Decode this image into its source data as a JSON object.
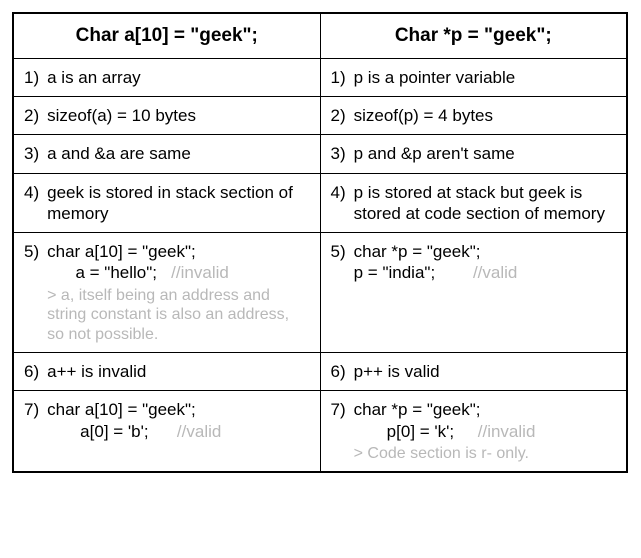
{
  "headers": {
    "left": "Char a[10] = \"geek\";",
    "right": "Char *p = \"geek\";"
  },
  "rows": [
    {
      "num": "1)",
      "left": {
        "text": "a is an array"
      },
      "right": {
        "text": "p is a pointer variable"
      }
    },
    {
      "num": "2)",
      "left": {
        "text": "sizeof(a) = 10 bytes"
      },
      "right": {
        "text": "sizeof(p) = 4 bytes"
      }
    },
    {
      "num": "3)",
      "left": {
        "text": "a and &a are same"
      },
      "right": {
        "text": "p and &p aren't same"
      }
    },
    {
      "num": "4)",
      "left": {
        "text": "geek is stored in stack section of memory"
      },
      "right": {
        "text": "p is stored at stack but geek is stored at code section of memory"
      }
    },
    {
      "num": "5)",
      "left": {
        "code1": "char a[10] = \"geek\";",
        "code2": "      a = \"hello\";",
        "comment2": "   //invalid",
        "note": "> a, itself being an address and string constant is also an address, so not possible."
      },
      "right": {
        "code1": "char *p = \"geek\";",
        "code2": "p = \"india\";",
        "comment2": "        //valid"
      }
    },
    {
      "num": "6)",
      "left": {
        "text": "a++ is invalid"
      },
      "right": {
        "text": "p++ is valid"
      }
    },
    {
      "num": "7)",
      "left": {
        "code1": "char a[10] = \"geek\";",
        "code2": "       a[0] = 'b';",
        "comment2": "      //valid"
      },
      "right": {
        "code1": "char *p = \"geek\";",
        "code2": "       p[0] = 'k';",
        "comment2": "     //invalid",
        "note": "> Code section is r- only."
      }
    }
  ]
}
